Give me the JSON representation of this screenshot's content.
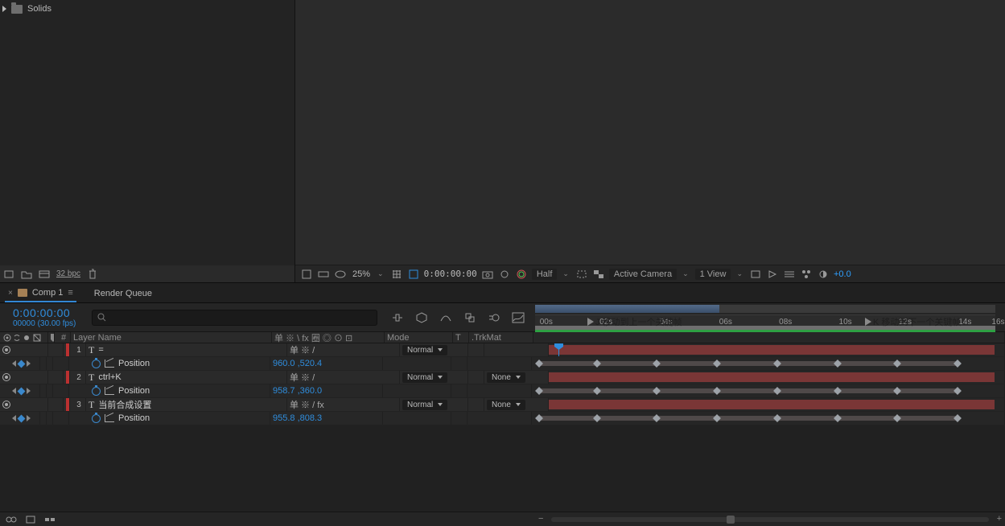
{
  "project": {
    "folder": "Solids",
    "bpc": "32 bpc"
  },
  "viewer": {
    "mag": "25%",
    "time": "0:00:00:00",
    "resolution": "Half",
    "camera": "Active Camera",
    "view": "1 View",
    "exposure": "+0.0"
  },
  "tabs": {
    "comp": "Comp 1",
    "renderqueue": "Render Queue"
  },
  "timeline": {
    "timecode": "0:00:00:00",
    "frames": "00000 (30.00 fps)",
    "markerJ": "J 移动到上一个关键帧",
    "markerK": "K 移动到下一个关键帧",
    "ticks": [
      "00s",
      "02s",
      "04s",
      "06s",
      "08s",
      "10s",
      "12s",
      "14s",
      "16s"
    ],
    "tickpos": [
      1,
      14,
      27,
      40,
      53,
      66,
      79,
      92,
      99.2
    ]
  },
  "cols": {
    "num": "#",
    "name": "Layer Name",
    "sw": "单 ※ \\ fx 圈 ◎ ⊙ ⊡",
    "mode": "Mode",
    "t": "T",
    "trk": ".TrkMat"
  },
  "modes": {
    "normal": "Normal",
    "none": "None"
  },
  "layers": [
    {
      "num": "1",
      "name": "=",
      "sw": "单 ※ /",
      "pos": "960.0 ,520.4"
    },
    {
      "num": "2",
      "name": "ctrl+K",
      "sw": "单 ※ /",
      "pos": "958.7 ,360.0"
    },
    {
      "num": "3",
      "name": "当前合成设置",
      "sw": "单 ※ / fx",
      "pos": "955.8 ,808.3"
    }
  ],
  "propname": "Position",
  "kfpos": [
    1.5,
    14,
    27,
    40,
    53,
    66,
    79,
    92
  ],
  "extent": [
    1.5,
    92
  ]
}
